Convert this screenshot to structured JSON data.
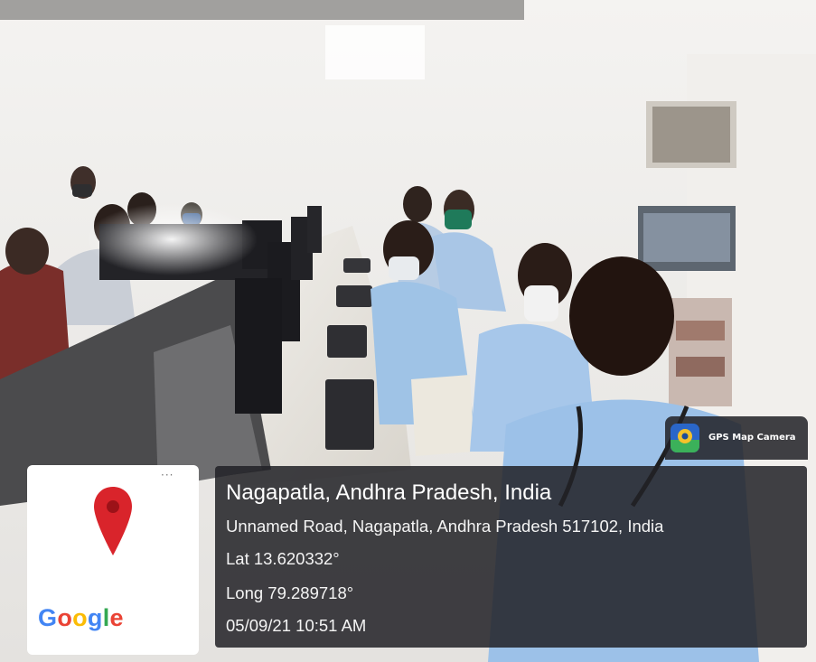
{
  "location": {
    "title": "Nagapatla, Andhra Pradesh, India",
    "address": "Unnamed Road, Nagapatla, Andhra Pradesh 517102, India",
    "lat": "Lat 13.620332°",
    "long": "Long 79.289718°",
    "datetime": "05/09/21 10:51 AM"
  },
  "map_card": {
    "menu_dots": "···",
    "pin_icon": "map-pin-icon",
    "pin_color": "#d9242b",
    "logo": {
      "letters": [
        "G",
        "o",
        "o",
        "g",
        "l",
        "e"
      ],
      "colors": [
        "#4285f4",
        "#ea4335",
        "#fbbc05",
        "#4285f4",
        "#34a853",
        "#ea4335"
      ]
    }
  },
  "app_badge": {
    "label": "GPS Map Camera",
    "icon": "gps-camera-app-icon"
  },
  "colors": {
    "panel": "#222226",
    "wall": "#e8e6e4",
    "shirt": "#9fc3e6"
  }
}
